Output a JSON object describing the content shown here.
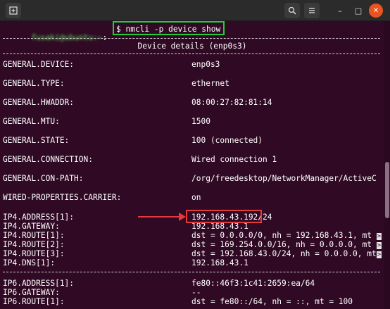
{
  "titlebar": {
    "new_tab_icon": "new-tab-icon",
    "search_icon": "search-icon",
    "menu_icon": "hamburger-icon",
    "minimize": "–",
    "maximize": "□",
    "close": "✕"
  },
  "prompt": {
    "user_host": "fusaki@ubuntu:~",
    "separator": ":",
    "command": "$ nmcli -p device show"
  },
  "header": {
    "title": "Device details (enp0s3)"
  },
  "rows": [
    {
      "key": "GENERAL.DEVICE:",
      "value": "enp0s3"
    },
    {
      "key": "GENERAL.TYPE:",
      "value": "ethernet"
    },
    {
      "key": "GENERAL.HWADDR:",
      "value": "08:00:27:82:81:14"
    },
    {
      "key": "GENERAL.MTU:",
      "value": "1500"
    },
    {
      "key": "GENERAL.STATE:",
      "value": "100 (connected)"
    },
    {
      "key": "GENERAL.CONNECTION:",
      "value": "Wired connection 1"
    },
    {
      "key": "GENERAL.CON-PATH:",
      "value": "/org/freedesktop/NetworkManager/ActiveC"
    },
    {
      "key": "WIRED-PROPERTIES.CARRIER:",
      "value": "on"
    }
  ],
  "ip4": [
    {
      "key": "IP4.ADDRESS[1]:",
      "value": "192.168.43.192/24"
    },
    {
      "key": "IP4.GATEWAY:",
      "value": "192.168.43.1"
    },
    {
      "key": "IP4.ROUTE[1]:",
      "value": "dst = 0.0.0.0/0, nh = 192.168.43.1, mt"
    },
    {
      "key": "IP4.ROUTE[2]:",
      "value": "dst = 169.254.0.0/16, nh = 0.0.0.0, mt"
    },
    {
      "key": "IP4.ROUTE[3]:",
      "value": "dst = 192.168.43.0/24, nh = 0.0.0.0, mt"
    },
    {
      "key": "IP4.DNS[1]:",
      "value": "192.168.43.1"
    }
  ],
  "ip6": [
    {
      "key": "IP6.ADDRESS[1]:",
      "value": "fe80::46f3:1c41:2659:ea/64"
    },
    {
      "key": "IP6.GATEWAY:",
      "value": "--"
    },
    {
      "key": "IP6.ROUTE[1]:",
      "value": "dst = fe80::/64, nh = ::, mt = 100"
    }
  ],
  "overflow_marker": ">",
  "colors": {
    "terminal_bg": "#300a24",
    "command_highlight": "#1ecf3a",
    "annotation": "#e23b3b",
    "close_button": "#e95420"
  }
}
